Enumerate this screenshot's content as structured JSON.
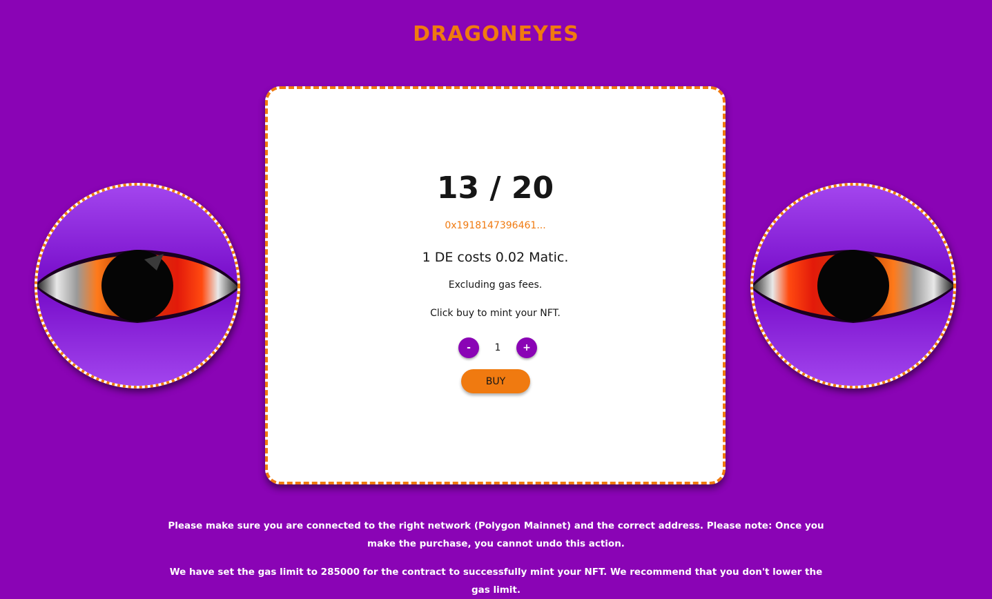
{
  "header": {
    "logo_text": "DRAGONEYES"
  },
  "mint_card": {
    "minted": 13,
    "supply": 20,
    "counter_text": "13 / 20",
    "wallet_address": "0x1918147396461...",
    "cost_text": "1 DE costs 0.02 Matic.",
    "gas_note": "Excluding gas fees.",
    "instruction": "Click buy to mint your NFT.",
    "quantity": {
      "minus_label": "-",
      "value": "1",
      "plus_label": "+"
    },
    "buy_label": "BUY"
  },
  "footer": {
    "network_notice": "Please make sure you are connected to the right network (Polygon Mainnet) and the correct address. Please note: Once you make the purchase, you cannot undo this action.",
    "gas_notice": "We have set the gas limit to 285000 for the contract to successfully mint your NFT. We recommend that you don't lower the gas limit."
  },
  "theme": {
    "background": "#8a04b5",
    "accent": "#f07a10",
    "card_background": "#ffffff",
    "text": "#161616"
  },
  "decorations": {
    "left_image": "dragon-eye-icon",
    "right_image": "dragon-eye-icon"
  }
}
